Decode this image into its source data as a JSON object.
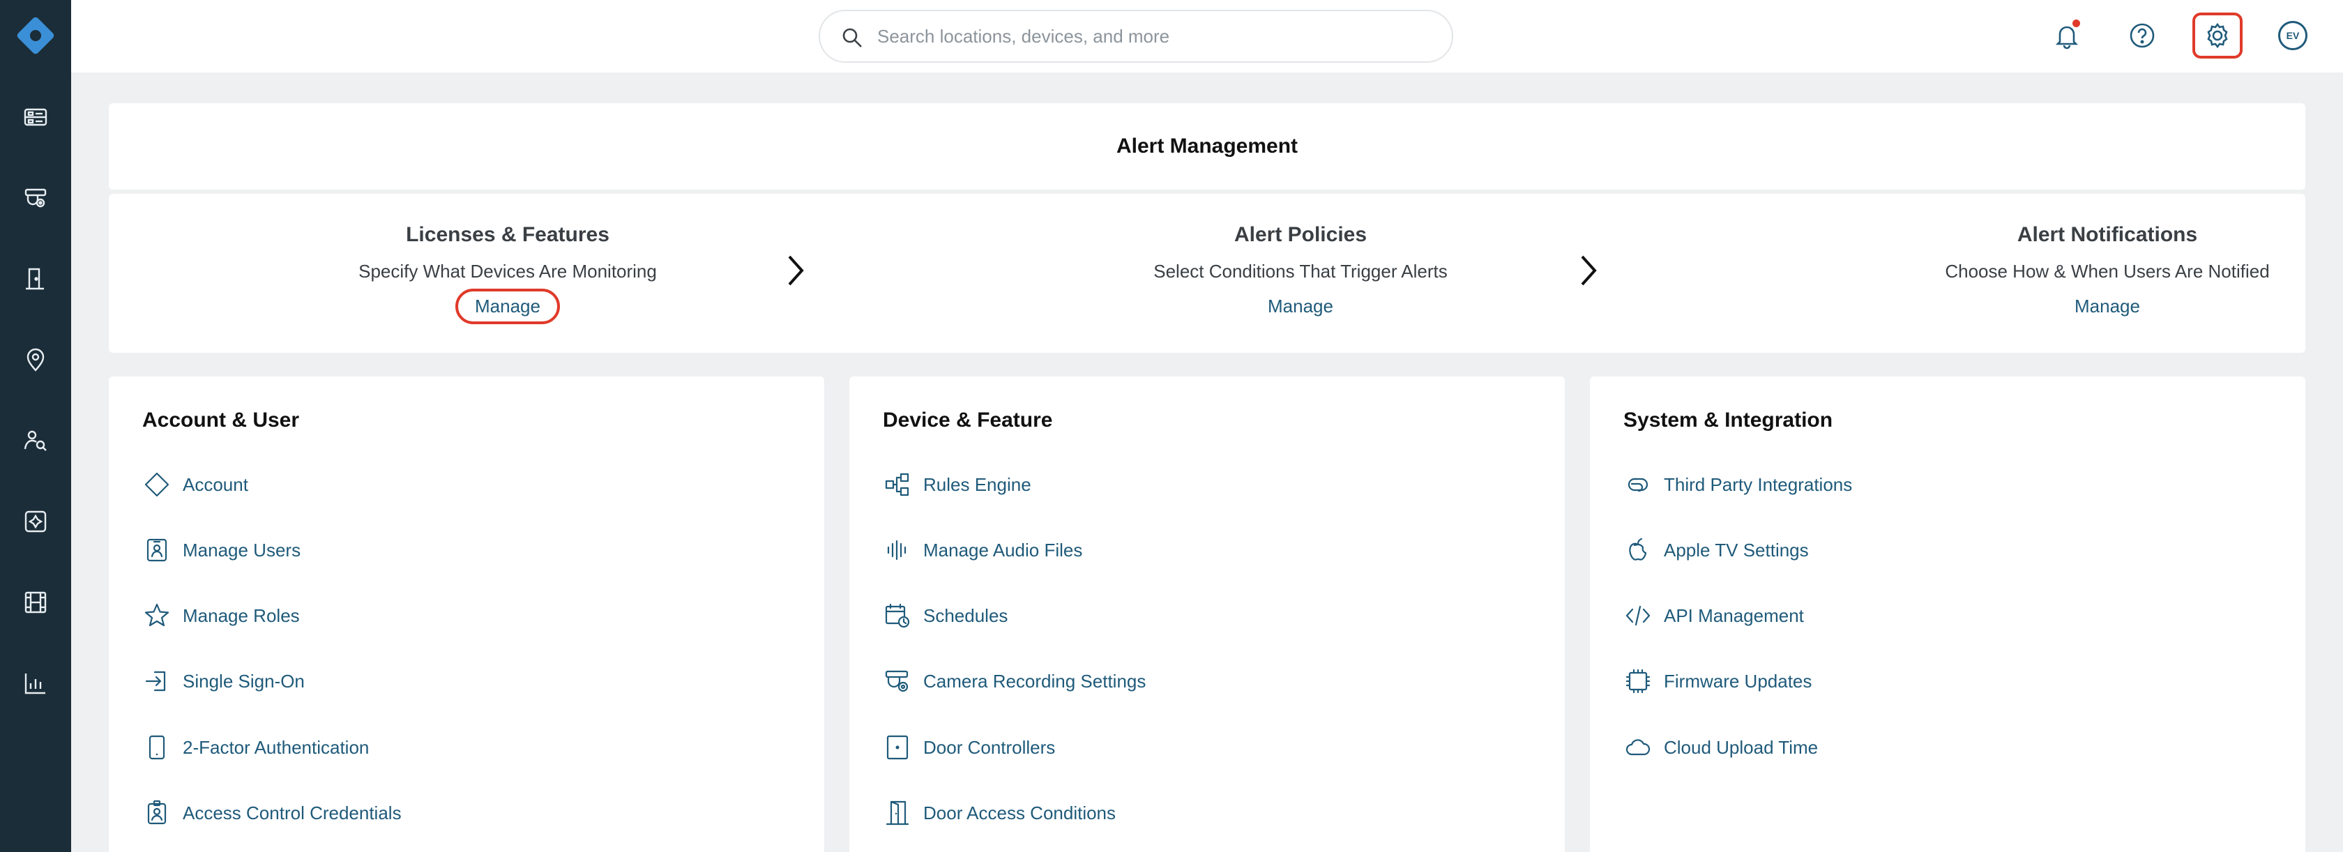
{
  "search": {
    "placeholder": "Search locations, devices, and more"
  },
  "header": {
    "avatar_initials": "EV"
  },
  "alert_management": {
    "title": "Alert Management",
    "steps": [
      {
        "title": "Licenses & Features",
        "description": "Specify What Devices Are Monitoring",
        "manage_label": "Manage"
      },
      {
        "title": "Alert Policies",
        "description": "Select Conditions That Trigger Alerts",
        "manage_label": "Manage"
      },
      {
        "title": "Alert Notifications",
        "description": "Choose How & When Users Are Notified",
        "manage_label": "Manage"
      }
    ]
  },
  "sections": [
    {
      "title": "Account & User",
      "items": [
        {
          "label": "Account",
          "icon": "diamond-icon"
        },
        {
          "label": "Manage Users",
          "icon": "user-badge-icon"
        },
        {
          "label": "Manage Roles",
          "icon": "star-icon"
        },
        {
          "label": "Single Sign-On",
          "icon": "sign-in-icon"
        },
        {
          "label": "2-Factor Authentication",
          "icon": "tablet-icon"
        },
        {
          "label": "Access Control Credentials",
          "icon": "id-badge-icon"
        }
      ]
    },
    {
      "title": "Device & Feature",
      "items": [
        {
          "label": "Rules Engine",
          "icon": "rules-engine-icon"
        },
        {
          "label": "Manage Audio Files",
          "icon": "audio-wave-icon"
        },
        {
          "label": "Schedules",
          "icon": "calendar-clock-icon"
        },
        {
          "label": "Camera Recording Settings",
          "icon": "camera-settings-icon"
        },
        {
          "label": "Door Controllers",
          "icon": "door-controller-icon"
        },
        {
          "label": "Door Access Conditions",
          "icon": "door-icon"
        }
      ]
    },
    {
      "title": "System & Integration",
      "items": [
        {
          "label": "Third Party Integrations",
          "icon": "link-icon"
        },
        {
          "label": "Apple TV Settings",
          "icon": "apple-icon"
        },
        {
          "label": "API Management",
          "icon": "code-icon"
        },
        {
          "label": "Firmware Updates",
          "icon": "chip-icon"
        },
        {
          "label": "Cloud Upload Time",
          "icon": "cloud-icon"
        }
      ]
    }
  ],
  "colors": {
    "sidebar": "#1b2d38",
    "accent": "#1f5a7a",
    "highlight": "#e03a2a",
    "background": "#eef0f2"
  }
}
